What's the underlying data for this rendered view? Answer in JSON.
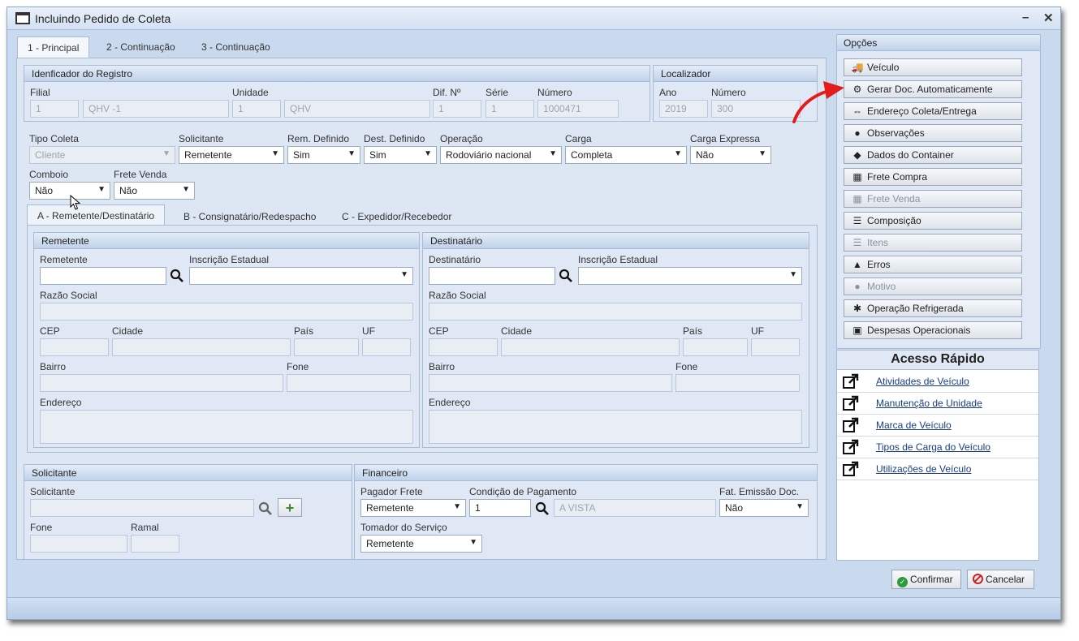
{
  "window": {
    "title": "Incluindo Pedido de Coleta",
    "minimize": "–",
    "close": "✕"
  },
  "tabs": [
    "1 - Principal",
    "2 - Continuação",
    "3 - Continuação"
  ],
  "registro": {
    "header": "Idenficador do Registro",
    "filial_label": "Filial",
    "filial_code": "1",
    "filial_name": "QHV -1",
    "unidade_label": "Unidade",
    "unidade_code": "1",
    "unidade_name": "QHV",
    "dif_label": "Dif. Nº",
    "dif_value": "1",
    "serie_label": "Série",
    "serie_value": "1",
    "numero_label": "Número",
    "numero_value": "1000471"
  },
  "localizador": {
    "header": "Localizador",
    "ano_label": "Ano",
    "ano_value": "2019",
    "numero_label": "Número",
    "numero_value": "300"
  },
  "fields": {
    "tipo_coleta": {
      "label": "Tipo Coleta",
      "value": "Cliente"
    },
    "solicitante": {
      "label": "Solicitante",
      "value": "Remetente"
    },
    "rem_definido": {
      "label": "Rem. Definido",
      "value": "Sim"
    },
    "dest_definido": {
      "label": "Dest. Definido",
      "value": "Sim"
    },
    "operacao": {
      "label": "Operação",
      "value": "Rodoviário nacional"
    },
    "carga": {
      "label": "Carga",
      "value": "Completa"
    },
    "carga_expressa": {
      "label": "Carga Expressa",
      "value": "Não"
    },
    "comboio": {
      "label": "Comboio",
      "value": "Não"
    },
    "frete_venda": {
      "label": "Frete Venda",
      "value": "Não"
    }
  },
  "subtabs": [
    "A - Remetente/Destinatário",
    "B - Consignatário/Redespacho",
    "C - Expedidor/Recebedor"
  ],
  "remetente": {
    "header": "Remetente",
    "name_label": "Remetente",
    "ie_label": "Inscrição Estadual",
    "razao_label": "Razão Social",
    "cep_label": "CEP",
    "cidade_label": "Cidade",
    "pais_label": "País",
    "uf_label": "UF",
    "bairro_label": "Bairro",
    "fone_label": "Fone",
    "endereco_label": "Endereço"
  },
  "destinatario": {
    "header": "Destinatário",
    "name_label": "Destinatário",
    "ie_label": "Inscrição Estadual",
    "razao_label": "Razão Social",
    "cep_label": "CEP",
    "cidade_label": "Cidade",
    "pais_label": "País",
    "uf_label": "UF",
    "bairro_label": "Bairro",
    "fone_label": "Fone",
    "endereco_label": "Endereço"
  },
  "solicitante_grp": {
    "header": "Solicitante",
    "solicitante_label": "Solicitante",
    "fone_label": "Fone",
    "ramal_label": "Ramal"
  },
  "financeiro": {
    "header": "Financeiro",
    "pagador_label": "Pagador Frete",
    "pagador_value": "Remetente",
    "condicao_label": "Condição de Pagamento",
    "condicao_code": "1",
    "condicao_desc": "A VISTA",
    "fat_label": "Fat. Emissão Doc.",
    "fat_value": "Não",
    "tomador_label": "Tomador do Serviço",
    "tomador_value": "Remetente"
  },
  "opcoes": {
    "header": "Opções",
    "items": [
      {
        "label": "Veículo",
        "icon": "truck-icon",
        "glyph": "🚚",
        "enabled": true
      },
      {
        "label": "Gerar Doc. Automaticamente",
        "icon": "gears-icon",
        "glyph": "⚙",
        "enabled": true
      },
      {
        "label": "Endereço Coleta/Entrega",
        "icon": "signpost-icon",
        "glyph": "⇔",
        "enabled": true
      },
      {
        "label": "Observações",
        "icon": "comment-icon",
        "glyph": "●",
        "enabled": true
      },
      {
        "label": "Dados do Container",
        "icon": "tags-icon",
        "glyph": "◆",
        "enabled": true
      },
      {
        "label": "Frete Compra",
        "icon": "calculator-icon",
        "glyph": "▦",
        "enabled": true
      },
      {
        "label": "Frete Venda",
        "icon": "calculator-icon",
        "glyph": "▦",
        "enabled": false
      },
      {
        "label": "Composição",
        "icon": "list-icon",
        "glyph": "☰",
        "enabled": true
      },
      {
        "label": "Itens",
        "icon": "list-icon",
        "glyph": "☰",
        "enabled": false
      },
      {
        "label": "Erros",
        "icon": "warning-icon",
        "glyph": "▲",
        "enabled": true
      },
      {
        "label": "Motivo",
        "icon": "comments-icon",
        "glyph": "●",
        "enabled": false
      },
      {
        "label": "Operação Refrigerada",
        "icon": "asterisk-icon",
        "glyph": "✱",
        "enabled": true
      },
      {
        "label": "Despesas Operacionais",
        "icon": "money-icon",
        "glyph": "▣",
        "enabled": true
      }
    ]
  },
  "acesso": {
    "header": "Acesso Rápido",
    "links": [
      "Atividades de Veículo",
      "Manutenção de Unidade",
      "Marca de Veículo",
      "Tipos de Carga do Veículo",
      "Utilizações de Veículo"
    ]
  },
  "actions": {
    "confirm": "Confirmar",
    "cancel": "Cancelar"
  },
  "colors": {
    "accent": "#c9d9ee",
    "arrow": "#e31b1b",
    "confirm": "#2e9a3a",
    "cancel": "#cc2222"
  }
}
